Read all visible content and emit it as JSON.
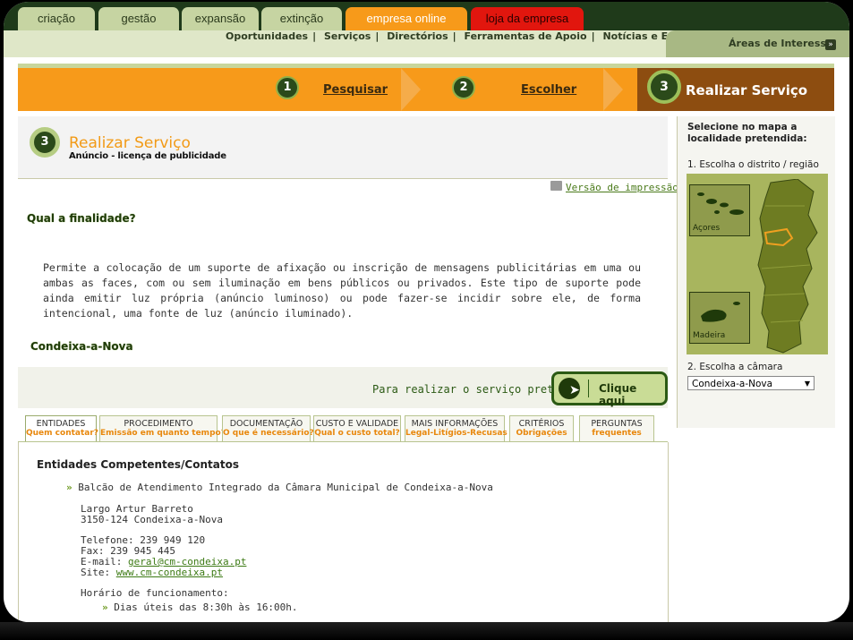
{
  "top_tabs": [
    {
      "label": "criação",
      "style": "green"
    },
    {
      "label": "gestão",
      "style": "green"
    },
    {
      "label": "expansão",
      "style": "green"
    },
    {
      "label": "extinção",
      "style": "green"
    },
    {
      "label": "empresa online",
      "style": "orange"
    },
    {
      "label": "loja da empresa",
      "style": "red"
    }
  ],
  "nav": {
    "links": [
      "Oportunidades",
      "Serviços",
      "Directórios",
      "Ferramentas de Apoio",
      "Notícias e Eventos"
    ],
    "areas_label": "Áreas de Interesse"
  },
  "steps": [
    {
      "num": "1",
      "label": "Pesquisar"
    },
    {
      "num": "2",
      "label": "Escolher"
    },
    {
      "num": "3",
      "label": "Realizar Serviço"
    }
  ],
  "main": {
    "step_num": "3",
    "title": "Realizar Serviço",
    "subtitle": "Anúncio - licença de publicidade",
    "print_label": "Versão de impressão",
    "question": "Qual a finalidade?",
    "description": "Permite a colocação de um suporte de afixação ou inscrição de mensagens publicitárias em uma ou ambas as faces, com ou sem iluminação em bens públicos ou privados. Este tipo de suporte pode ainda emitir luz própria (anúncio luminoso) ou pode fazer-se incidir sobre ele, de forma intencional, uma fonte de luz (anúncio iluminado).",
    "place": "Condeixa-a-Nova",
    "action_text": "Para realizar o serviço pretendido",
    "action_button": "Clique aqui"
  },
  "info_tabs": [
    {
      "top": "ENTIDADES",
      "bottom": "Quem contatar?"
    },
    {
      "top": "PROCEDIMENTO",
      "bottom": "Emissão em quanto tempo?"
    },
    {
      "top": "DOCUMENTAÇÃO",
      "bottom": "O que é necessário?"
    },
    {
      "top": "CUSTO E VALIDADE",
      "bottom": "Qual o custo total?"
    },
    {
      "top": "MAIS INFORMAÇÕES",
      "bottom": "Legal-Litígios-Recusas"
    },
    {
      "top": "CRITÉRIOS",
      "bottom": "Obrigações"
    },
    {
      "top": "PERGUNTAS",
      "bottom": "frequentes"
    }
  ],
  "entities": {
    "title": "Entidades Competentes/Contatos",
    "name": "Balcão de Atendimento Integrado da Câmara Municipal de Condeixa-a-Nova",
    "address1": "Largo Artur Barreto",
    "address2": "3150-124 Condeixa-a-Nova",
    "phone": "Telefone: 239 949 120",
    "fax": "Fax: 239 945 445",
    "email_label": "E-mail: ",
    "email": "geral@cm-condeixa.pt",
    "site_label": "Site: ",
    "site": "www.cm-condeixa.pt",
    "hours_label": "Horário de funcionamento:",
    "hours": "Dias úteis das 8:30h às 16:00h."
  },
  "right_panel": {
    "title": "Selecione no mapa a localidade pretendida:",
    "step1": "1. Escolha o distrito / região",
    "azores": "Açores",
    "madeira": "Madeira",
    "step2": "2. Escolha a câmara",
    "selected": "Condeixa-a-Nova"
  }
}
